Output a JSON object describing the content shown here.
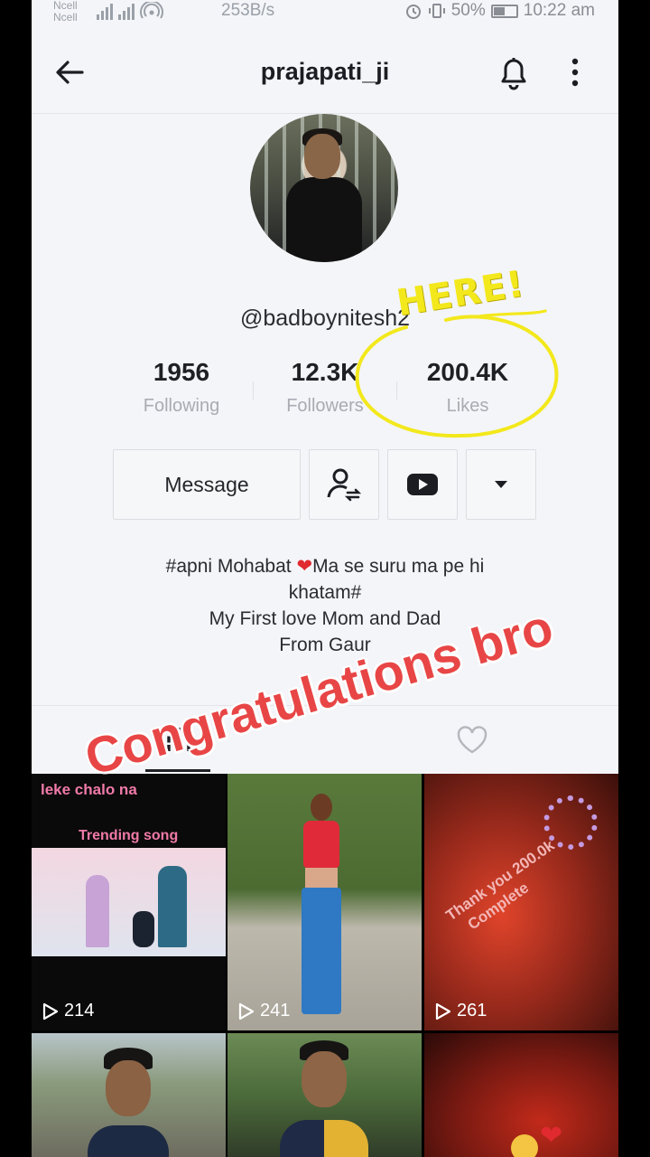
{
  "status_bar": {
    "carrier_1": "Ncell",
    "carrier_2": "Ncell",
    "speed": "253B/s",
    "battery": "50%",
    "time": "10:22 am"
  },
  "header": {
    "title": "prajapati_ji",
    "back_icon": "arrow-left-icon",
    "bell_icon": "bell-icon",
    "more_icon": "more-vertical-icon"
  },
  "profile": {
    "handle": "@badboynitesh2",
    "stats": [
      {
        "value": "1956",
        "label": "Following"
      },
      {
        "value": "12.3K",
        "label": "Followers"
      },
      {
        "value": "200.4K",
        "label": "Likes"
      }
    ],
    "message_label": "Message",
    "bio_line1_a": "#apni Mohabat ",
    "bio_line1_b": "Ma se suru ma pe hi",
    "bio_line2": "khatam#",
    "bio_line3": "My First love Mom and Dad",
    "bio_line4": "From Gaur"
  },
  "videos": [
    {
      "views": "214",
      "caption_top": "leke chalo na",
      "caption_sub": "Trending song"
    },
    {
      "views": "241"
    },
    {
      "views": "261",
      "caption_top": "Thank you 200.0k",
      "caption_sub": "Complete"
    },
    {
      "views": ""
    },
    {
      "views": ""
    },
    {
      "views": ""
    }
  ],
  "overlay": {
    "here": "HERE!",
    "congrats": "Congratulations bro"
  },
  "colors": {
    "accent_heart": "#e02a2f",
    "highlight_yellow": "#f3e81c",
    "congrats_red": "#e84646"
  }
}
